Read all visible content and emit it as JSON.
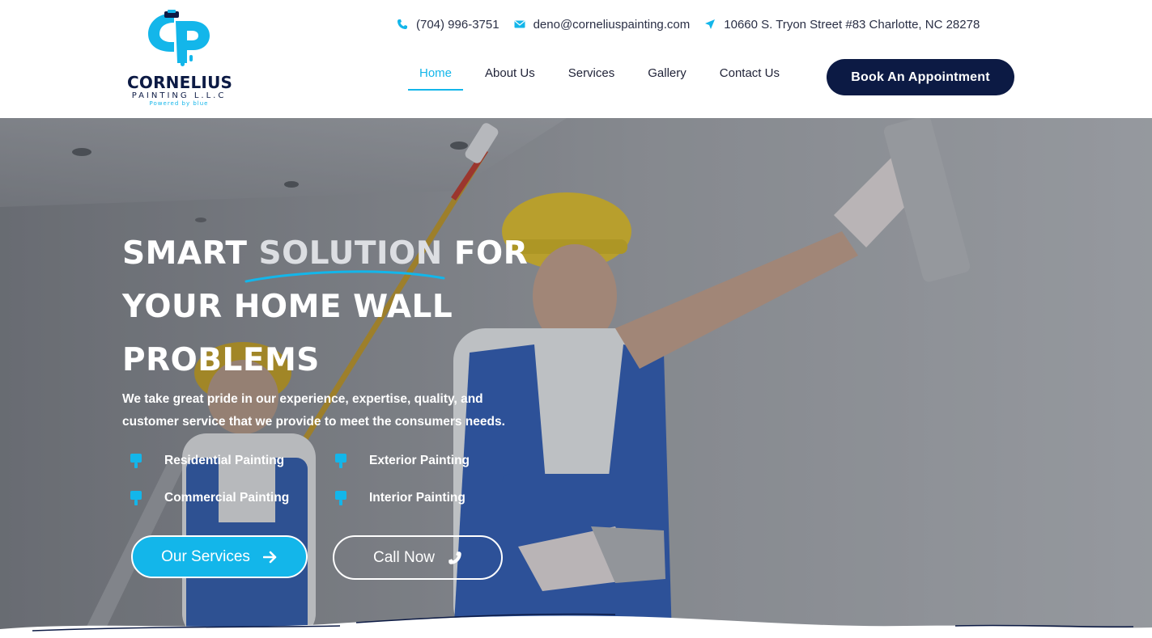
{
  "brand": {
    "name": "CORNELIUS",
    "sub": "PAINTING L.L.C",
    "tagline": "Powered by blue",
    "primary_color": "#13b6ea",
    "navy_color": "#0c1a44"
  },
  "contact": {
    "phone": "(704) 996-3751",
    "email": "deno@corneliuspainting.com",
    "address": "10660 S. Tryon Street #83 Charlotte, NC 28278",
    "phone_icon": "phone-icon",
    "email_icon": "envelope-icon",
    "address_icon": "location-arrow-icon"
  },
  "nav": {
    "items": [
      {
        "label": "Home",
        "active": true
      },
      {
        "label": "About Us",
        "active": false
      },
      {
        "label": "Services",
        "active": false
      },
      {
        "label": "Gallery",
        "active": false
      },
      {
        "label": "Contact Us",
        "active": false
      }
    ],
    "cta_label": "Book An Appointment"
  },
  "hero": {
    "headline_part1": "SMART",
    "headline_accent": "SOLUTION",
    "headline_part2": "FOR",
    "headline_line2": "YOUR HOME WALL",
    "headline_line3": "PROBLEMS",
    "description_line1": "We take great pride in our experience, expertise, quality, and",
    "description_line2": "customer service that we provide to meet the consumers needs.",
    "features": [
      "Residential Painting",
      "Exterior Painting",
      "Commercial Painting",
      "Interior Painting"
    ],
    "feature_icon": "paint-brush-icon",
    "btn_services": "Our Services",
    "btn_services_icon": "arrow-right-icon",
    "btn_call": "Call Now",
    "btn_call_icon": "phone-icon"
  }
}
